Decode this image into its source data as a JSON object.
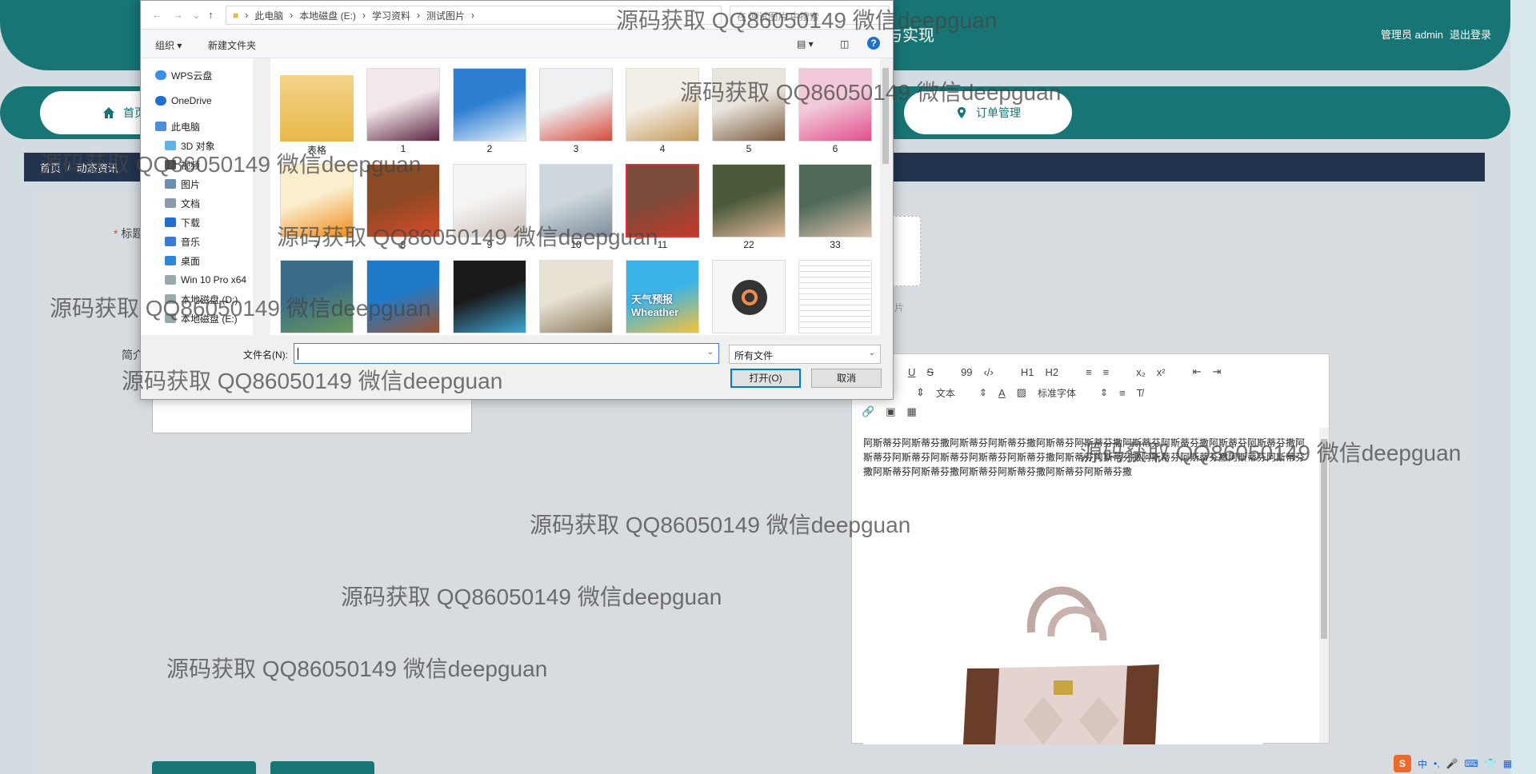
{
  "header": {
    "title_fragment": "与实现",
    "user": "管理员 admin",
    "logout": "退出登录"
  },
  "nav": {
    "home": "首页",
    "orders": "订单管理"
  },
  "breadcrumb": {
    "home": "首页",
    "sep": "/",
    "current": "动态资讯"
  },
  "form": {
    "title_label": "标题",
    "intro_label": "简介",
    "upload_hint": "图片"
  },
  "editor": {
    "toolbar_row1": [
      "U",
      "S",
      "99",
      "‹/›",
      "H1",
      "H2",
      "≡",
      "≡",
      "x₂",
      "x²",
      "⇤",
      "⇥"
    ],
    "toolbar_row2": {
      "size_select": "文本",
      "font_select": "标准字体"
    },
    "body_text": "阿斯蒂芬阿斯蒂芬撒阿斯蒂芬阿斯蒂芬撒阿斯蒂芬阿斯蒂芬撒阿斯蒂芬阿斯蒂芬撒阿斯蒂芬阿斯蒂芬撒阿斯蒂芬阿斯蒂芬阿斯蒂芬阿斯蒂芬阿斯蒂芬撒阿斯蒂芬阿斯蒂芬撒阿斯蒂芬阿斯蒂芬撒阿斯蒂芬阿斯蒂芬撒阿斯蒂芬阿斯蒂芬撒阿斯蒂芬阿斯蒂芬撒阿斯蒂芬阿斯蒂芬撒"
  },
  "dialog": {
    "path": [
      "此电脑",
      "本地磁盘 (E:)",
      "学习资料",
      "测试图片"
    ],
    "search_placeholder": "在 测试图片 中搜索",
    "organize": "组织 ▾",
    "new_folder": "新建文件夹",
    "tree": [
      "WPS云盘",
      "OneDrive",
      "此电脑",
      "3D 对象",
      "视频",
      "图片",
      "文档",
      "下载",
      "音乐",
      "桌面",
      "Win 10 Pro x64",
      "本地磁盘 (D:)",
      "本地磁盘 (E:)"
    ],
    "files": [
      {
        "name": "表格",
        "kind": "folder"
      },
      {
        "name": "1",
        "kind": "fruit"
      },
      {
        "name": "2",
        "kind": "box"
      },
      {
        "name": "3",
        "kind": "bucket"
      },
      {
        "name": "4",
        "kind": "lamp"
      },
      {
        "name": "5",
        "kind": "figure"
      },
      {
        "name": "6",
        "kind": "books"
      },
      {
        "name": "7",
        "kind": "juice"
      },
      {
        "name": "8",
        "kind": "snack"
      },
      {
        "name": "9",
        "kind": "bag"
      },
      {
        "name": "10",
        "kind": "fish"
      },
      {
        "name": "11",
        "kind": "portrait"
      },
      {
        "name": "22",
        "kind": "soldier"
      },
      {
        "name": "33",
        "kind": "soldier2"
      },
      {
        "name": "",
        "kind": "map"
      },
      {
        "name": "",
        "kind": "archive"
      },
      {
        "name": "",
        "kind": "tiles"
      },
      {
        "name": "",
        "kind": "icons"
      },
      {
        "name": "天气预报 Wheather",
        "kind": "weather"
      },
      {
        "name": "",
        "kind": "music"
      },
      {
        "name": "",
        "kind": "doc"
      }
    ],
    "filename_label": "文件名(N):",
    "filetype": "所有文件",
    "open": "打开(O)",
    "cancel": "取消"
  },
  "watermark": "源码获取 QQ86050149 微信deepguan",
  "ime": {
    "lang": "中",
    "punct": "•,"
  }
}
